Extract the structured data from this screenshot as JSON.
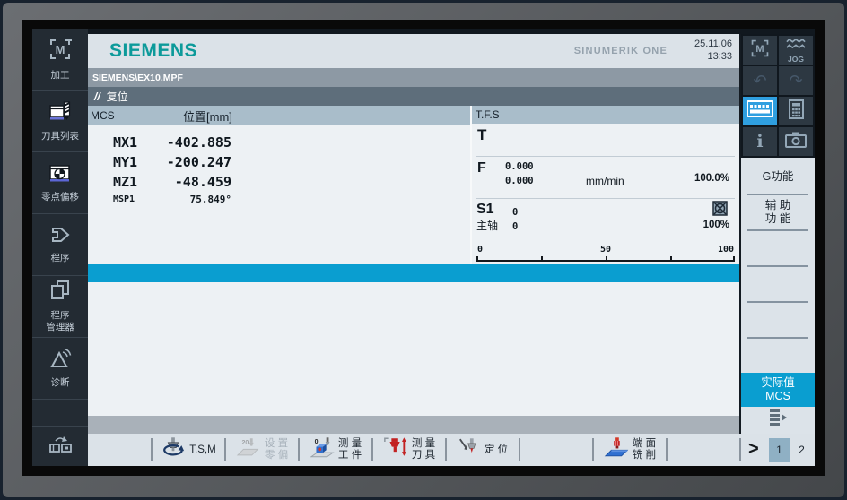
{
  "titlebar": {
    "brand": "SIEMENS",
    "product": "SINUMERIK ONE",
    "date": "25.11.06",
    "time": "13:33"
  },
  "program_path": "SIEMENS\\EX10.MPF",
  "channel_state": {
    "icon": "//",
    "label": "复位"
  },
  "nav_items": [
    {
      "line1": "加工",
      "line2": ""
    },
    {
      "line1": "刀具列表",
      "line2": ""
    },
    {
      "line1": "零点偏移",
      "line2": ""
    },
    {
      "line1": "程序",
      "line2": ""
    },
    {
      "line1": "程序",
      "line2": "管理器"
    },
    {
      "line1": "诊断",
      "line2": ""
    }
  ],
  "mcs": {
    "title": "MCS",
    "position_header": "位置[mm]",
    "axes": [
      {
        "name": "MX1",
        "value": "-402.885"
      },
      {
        "name": "MY1",
        "value": "-200.247"
      },
      {
        "name": "MZ1",
        "value": "-48.459"
      },
      {
        "name": "MSP1",
        "value": "75.849°"
      }
    ]
  },
  "tfs": {
    "title": "T.F.S",
    "tool_label": "T",
    "feed_label": "F",
    "feed_actual": "0.000",
    "feed_setpoint": "0.000",
    "feed_unit": "mm/min",
    "feed_override": "100.0%",
    "spindle_label": "S1",
    "spindle_name": "主轴",
    "spindle_actual": "0",
    "spindle_setpoint": "0",
    "spindle_override": "100%",
    "scale_ticks": [
      "0",
      "50",
      "100"
    ]
  },
  "hardkeys": {
    "jog_label": "JOG",
    "undo_glyph": "↶",
    "redo_glyph": "↷",
    "info_glyph": "i"
  },
  "right_softkeys": [
    {
      "line1": "G功能",
      "line2": ""
    },
    {
      "line1": "辅 助",
      "line2": "功 能"
    },
    {
      "line1": "",
      "line2": ""
    },
    {
      "line1": "",
      "line2": ""
    },
    {
      "line1": "",
      "line2": ""
    },
    {
      "line1": "",
      "line2": ""
    },
    {
      "line1": "实际值",
      "line2": "MCS"
    }
  ],
  "bottom_softkeys": [
    {
      "line1": "T,S,M",
      "line2": ""
    },
    {
      "line1": "设 置",
      "line2": "零 偏"
    },
    {
      "line1": "测 量",
      "line2": "工 件"
    },
    {
      "line1": "测 量",
      "line2": "刀 具"
    },
    {
      "line1": "定 位",
      "line2": ""
    },
    {
      "line1": "",
      "line2": ""
    },
    {
      "line1": "端 面",
      "line2": "铣 削"
    },
    {
      "line1": "",
      "line2": ""
    }
  ],
  "menu_next": ">",
  "pages": [
    "1",
    "2"
  ],
  "colors": {
    "accent_cyan": "#0a9ed0",
    "active_blue": "#2f9fe0",
    "brand_teal": "#0c9a9a"
  }
}
